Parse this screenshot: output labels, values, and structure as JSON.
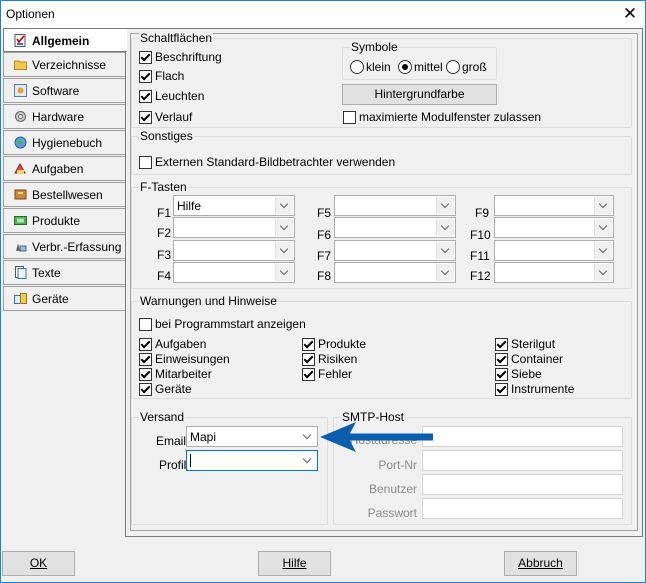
{
  "window": {
    "title": "Optionen"
  },
  "tabs": [
    {
      "label": "Allgemein",
      "icon": "checklist-icon",
      "active": true
    },
    {
      "label": "Verzeichnisse",
      "icon": "folder-icon"
    },
    {
      "label": "Software",
      "icon": "software-icon"
    },
    {
      "label": "Hardware",
      "icon": "gear-icon"
    },
    {
      "label": "Hygienebuch",
      "icon": "globe-icon"
    },
    {
      "label": "Aufgaben",
      "icon": "tasks-icon"
    },
    {
      "label": "Bestellwesen",
      "icon": "order-icon"
    },
    {
      "label": "Produkte",
      "icon": "products-icon"
    },
    {
      "label": "Verbr.-Erfassung",
      "icon": "consumption-icon"
    },
    {
      "label": "Texte",
      "icon": "document-icon"
    },
    {
      "label": "Geräte",
      "icon": "devices-icon"
    }
  ],
  "schaltflaechen": {
    "title": "Schaltflächen",
    "items": [
      {
        "label": "Beschriftung",
        "checked": true
      },
      {
        "label": "Flach",
        "checked": true
      },
      {
        "label": "Leuchten",
        "checked": true
      },
      {
        "label": "Verlauf",
        "checked": true
      }
    ],
    "symbole": {
      "title": "Symbole",
      "options": [
        {
          "label": "klein",
          "selected": false
        },
        {
          "label": "mittel",
          "selected": true
        },
        {
          "label": "groß",
          "selected": false
        }
      ]
    },
    "background_button": "Hintergrundfarbe",
    "maximized_label": "maximierte Modulfenster zulassen"
  },
  "sonstiges": {
    "title": "Sonstiges",
    "viewer_label": "Externen Standard-Bildbetrachter verwenden"
  },
  "ftasten": {
    "title": "F-Tasten",
    "keys": [
      {
        "key": "F1",
        "value": "Hilfe"
      },
      {
        "key": "F2",
        "value": ""
      },
      {
        "key": "F3",
        "value": ""
      },
      {
        "key": "F4",
        "value": ""
      },
      {
        "key": "F5",
        "value": ""
      },
      {
        "key": "F6",
        "value": ""
      },
      {
        "key": "F7",
        "value": ""
      },
      {
        "key": "F8",
        "value": ""
      },
      {
        "key": "F9",
        "value": ""
      },
      {
        "key": "F10",
        "value": ""
      },
      {
        "key": "F11",
        "value": ""
      },
      {
        "key": "F12",
        "value": ""
      }
    ]
  },
  "warnungen": {
    "title": "Warnungen und Hinweise",
    "startup_label": "bei Programmstart anzeigen",
    "items": [
      {
        "label": "Aufgaben",
        "checked": true
      },
      {
        "label": "Einweisungen",
        "checked": true
      },
      {
        "label": "Mitarbeiter",
        "checked": true
      },
      {
        "label": "Geräte",
        "checked": true
      },
      {
        "label": "Produkte",
        "checked": true
      },
      {
        "label": "Risiken",
        "checked": true
      },
      {
        "label": "Fehler",
        "checked": true
      },
      {
        "label": "Sterilgut",
        "checked": true
      },
      {
        "label": "Container",
        "checked": true
      },
      {
        "label": "Siebe",
        "checked": true
      },
      {
        "label": "Instrumente",
        "checked": true
      }
    ]
  },
  "versand": {
    "title": "Versand",
    "email_label": "Email",
    "email_value": "Mapi",
    "profil_label": "Profil",
    "profil_value": ""
  },
  "smtp": {
    "title": "SMTP-Host",
    "hostadresse_label": "Hostadresse",
    "port_label": "Port-Nr",
    "benutzer_label": "Benutzer",
    "passwort_label": "Passwort"
  },
  "buttons": {
    "ok": "OK",
    "hilfe": "Hilfe",
    "abbruch": "Abbruch"
  },
  "colors": {
    "accent": "#0b5dae",
    "window_border": "#1883d7"
  }
}
